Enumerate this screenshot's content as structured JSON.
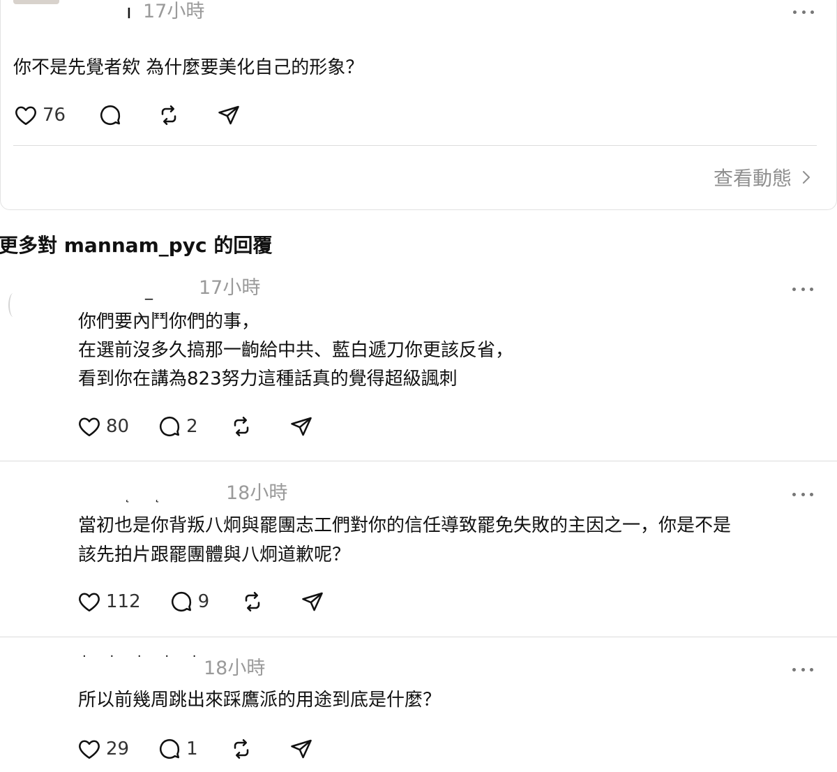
{
  "top_post": {
    "time": "17小時",
    "text": "你不是先覺者欸 為什麼要美化自己的形象？",
    "likes": "76",
    "view_activity": "查看動態"
  },
  "section": {
    "title": "更多對 mannam_pyc 的回覆"
  },
  "replies": [
    {
      "time": "17小時",
      "lines": [
        "你們要內鬥你們的事，",
        "在選前沒多久搞那一齣給中共、藍白遞刀你更該反省，",
        "看到你在講為823努力這種話真的覺得超級諷刺"
      ],
      "likes": "80",
      "comments": "2"
    },
    {
      "time": "18小時",
      "lines": [
        "當初也是你背叛八炯與罷團志工們對你的信任導致罷免失敗的主因之一，你是不是",
        "該先拍片跟罷團體與八炯道歉呢？"
      ],
      "likes": "112",
      "comments": "9"
    },
    {
      "time": "18小時",
      "lines": [
        "所以前幾周跳出來踩鷹派的用途到底是什麼？"
      ],
      "likes": "29",
      "comments": "1"
    }
  ],
  "icons": {
    "like": "heart-icon",
    "comment": "comment-icon",
    "repost": "repost-icon",
    "share": "send-icon",
    "more": "more-icon",
    "chevron": "chevron-right-icon"
  }
}
